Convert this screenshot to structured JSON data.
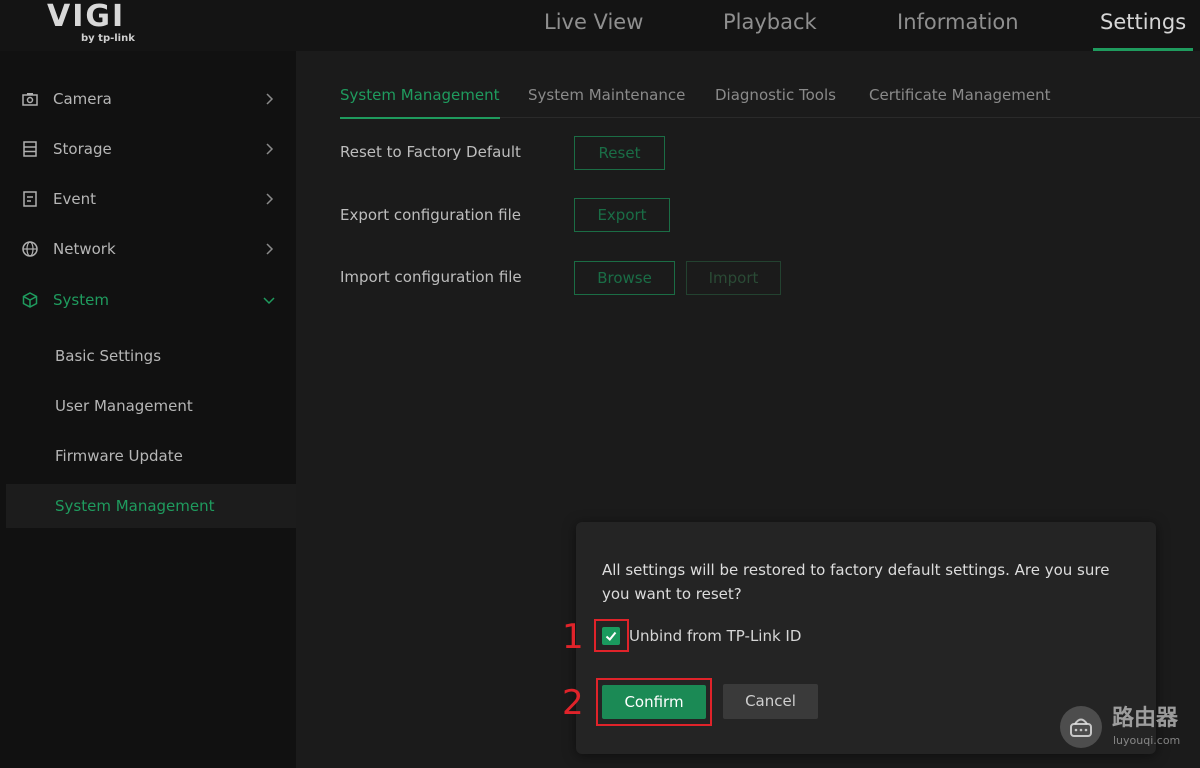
{
  "brand": {
    "logo": "VIGI",
    "sub": "by tp-link"
  },
  "topnav": [
    {
      "label": "Live View"
    },
    {
      "label": "Playback"
    },
    {
      "label": "Information"
    },
    {
      "label": "Settings",
      "active": true
    }
  ],
  "sidebar": {
    "items": [
      {
        "label": "Camera",
        "icon": "camera-icon"
      },
      {
        "label": "Storage",
        "icon": "storage-icon"
      },
      {
        "label": "Event",
        "icon": "event-icon"
      },
      {
        "label": "Network",
        "icon": "globe-icon"
      },
      {
        "label": "System",
        "icon": "cube-icon",
        "active": true,
        "expanded": true
      }
    ],
    "subitems": [
      {
        "label": "Basic Settings"
      },
      {
        "label": "User Management"
      },
      {
        "label": "Firmware Update"
      },
      {
        "label": "System Management",
        "active": true
      }
    ]
  },
  "tabs": [
    {
      "label": "System Management",
      "active": true
    },
    {
      "label": "System Maintenance"
    },
    {
      "label": "Diagnostic Tools"
    },
    {
      "label": "Certificate Management"
    }
  ],
  "rows": {
    "reset": {
      "label": "Reset to Factory Default",
      "button": "Reset"
    },
    "export": {
      "label": "Export configuration file",
      "button": "Export"
    },
    "import": {
      "label": "Import configuration file",
      "browse": "Browse",
      "import": "Import"
    }
  },
  "dialog": {
    "message": "All settings will be restored to factory default settings. Are you sure you want to reset?",
    "checkbox_label": "Unbind from TP-Link ID",
    "checkbox_checked": true,
    "confirm": "Confirm",
    "cancel": "Cancel"
  },
  "annotations": {
    "step1": "1",
    "step2": "2"
  },
  "watermark": {
    "cn": "路由器",
    "url": "luyouqi.com"
  },
  "colors": {
    "accent": "#1f9b5e",
    "annotation": "#e0232a"
  }
}
